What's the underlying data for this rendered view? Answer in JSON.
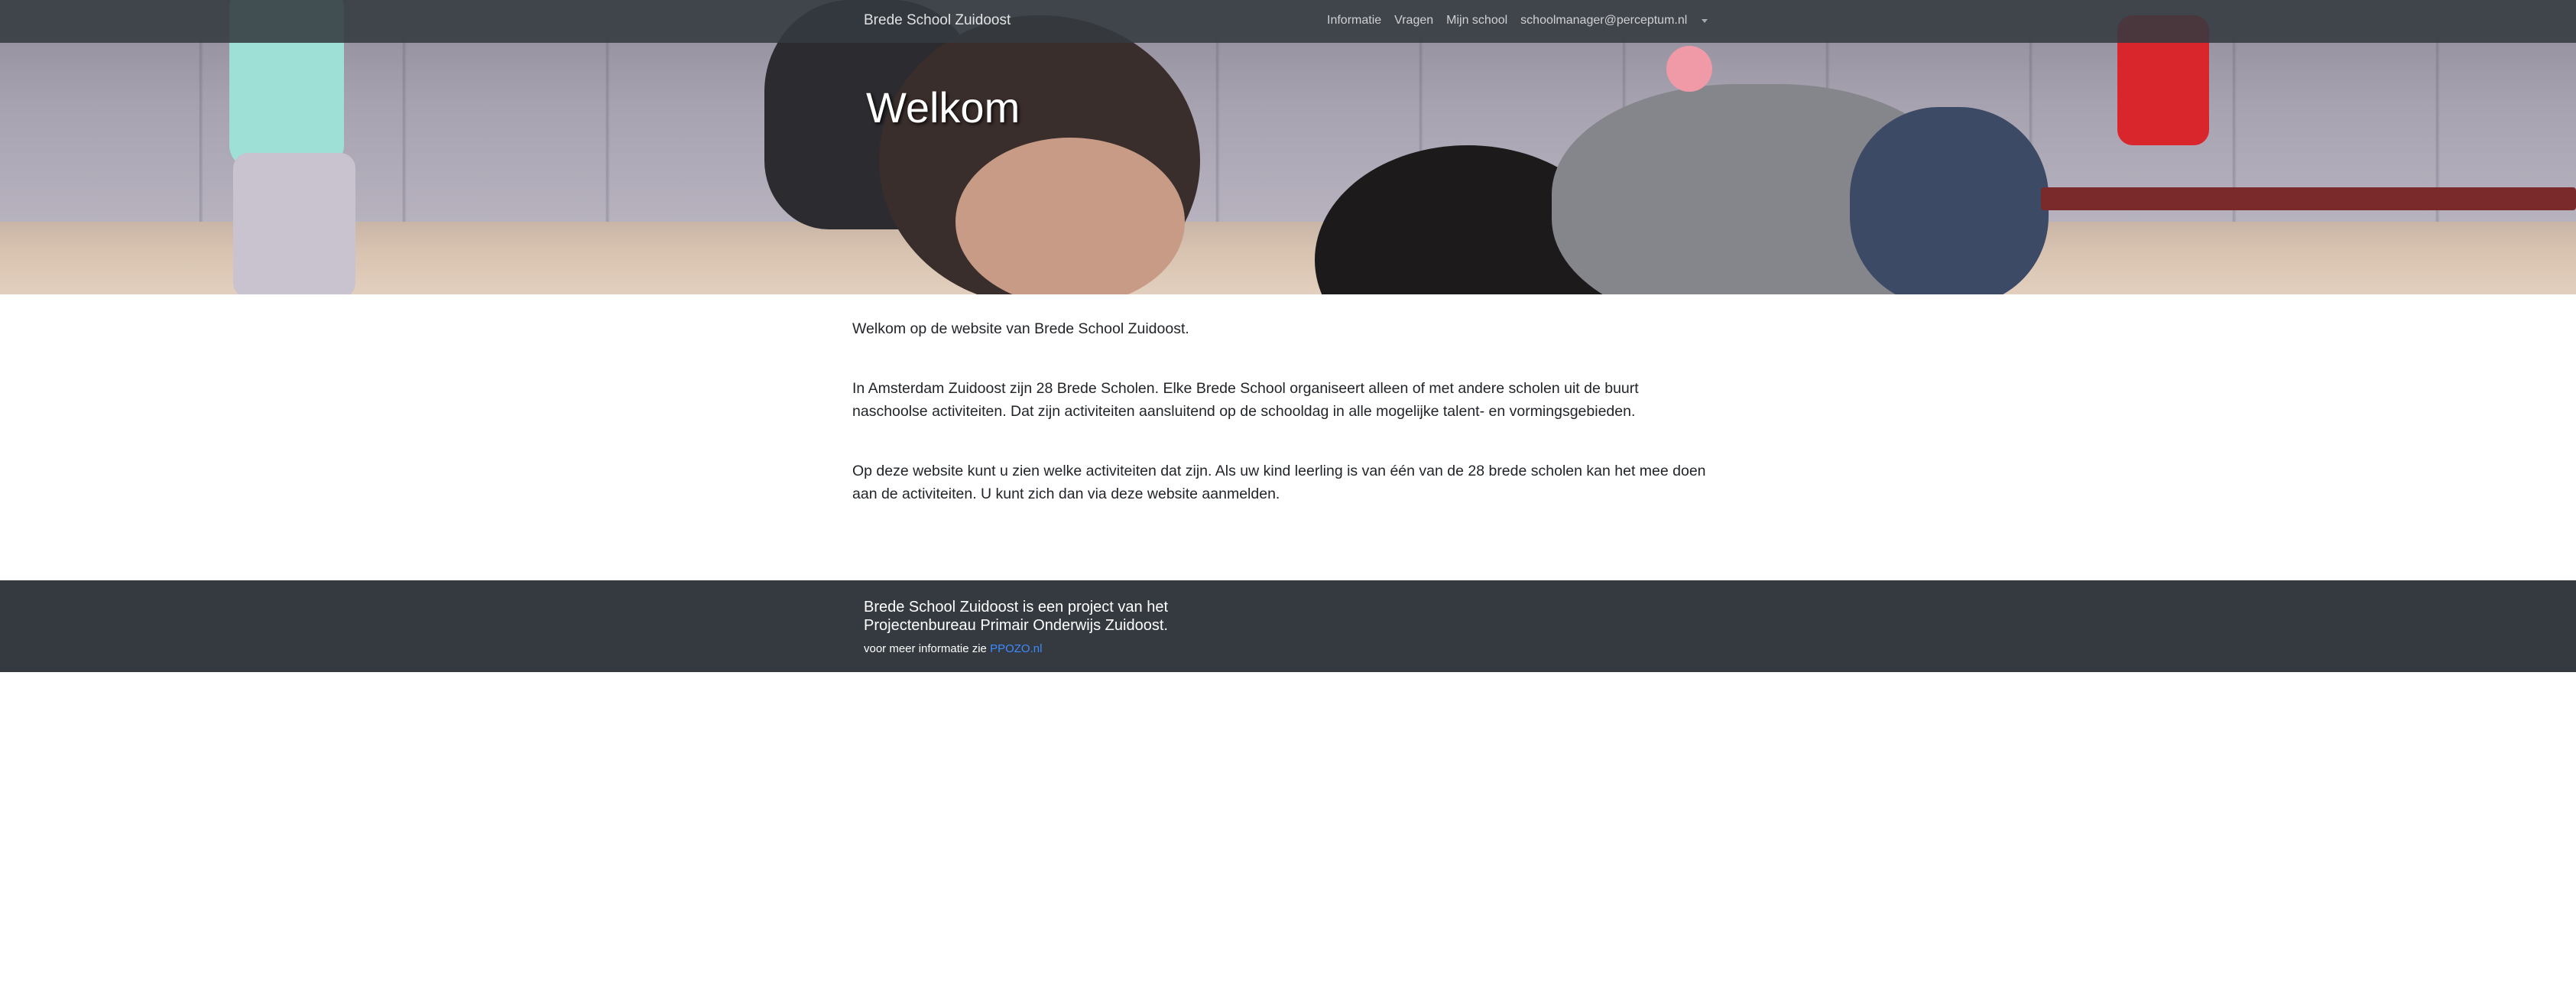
{
  "navbar": {
    "brand": "Brede School Zuidoost",
    "items": [
      "Informatie",
      "Vragen",
      "Mijn school",
      "schoolmanager@perceptum.nl"
    ]
  },
  "hero": {
    "title": "Welkom"
  },
  "content": {
    "paragraphs": [
      "Welkom op de website van Brede School Zuidoost.",
      "In Amsterdam Zuidoost zijn 28 Brede Scholen. Elke Brede School organiseert alleen of met andere scholen uit de buurt naschoolse activiteiten. Dat zijn activiteiten aansluitend op de schooldag in alle mogelijke talent- en vormingsgebieden.",
      "Op deze website kunt u zien welke activiteiten dat zijn. Als uw kind leerling is van één van de 28 brede scholen kan het mee doen aan de activiteiten. U kunt zich dan via deze website aanmelden."
    ]
  },
  "footer": {
    "title": "Brede School Zuidoost is een project van het Projectenbureau Primair Onderwijs Zuidoost.",
    "info_prefix": "voor meer informatie zie",
    "link_text": "PPOZO.nl"
  }
}
